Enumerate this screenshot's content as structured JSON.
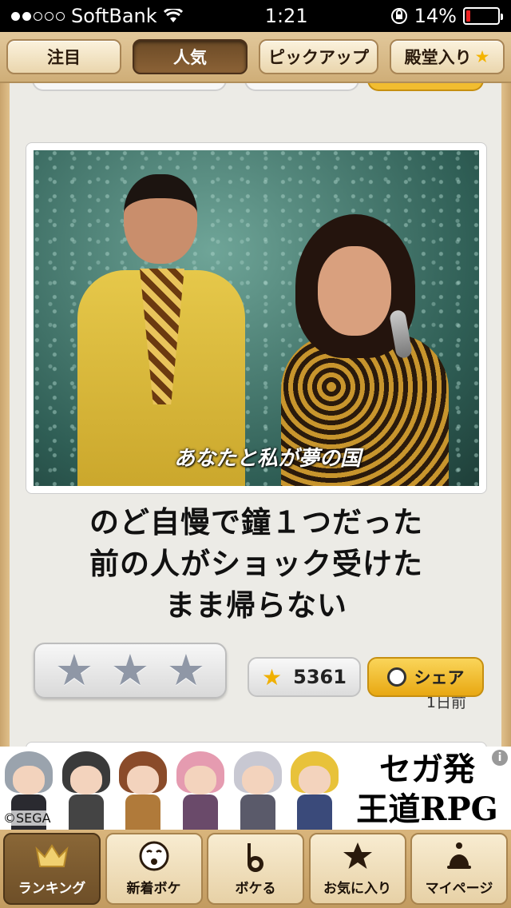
{
  "status_bar": {
    "carrier": "SoftBank",
    "time": "1:21",
    "battery": "14%",
    "battery_level": 0.14
  },
  "top_tabs": [
    {
      "label": "注目",
      "active": false
    },
    {
      "label": "人気",
      "active": true
    },
    {
      "label": "ピックアップ",
      "active": false
    },
    {
      "label": "殿堂入り",
      "active": false,
      "star": "★"
    }
  ],
  "post": {
    "image_caption": "あなたと私が夢の国",
    "title_lines": [
      "のど自慢で鐘１つだった",
      "前の人がショック受けた",
      "まま帰らない"
    ],
    "time_ago": "1日前",
    "rating_stars": 3,
    "score": "5361",
    "share_label": "シェア"
  },
  "ad": {
    "copyright": "©SEGA",
    "line1": "セガ発",
    "line2": "王道RPG",
    "info": "i"
  },
  "bottom_tabs": [
    {
      "label": "ランキング",
      "icon": "crown-icon",
      "active": true
    },
    {
      "label": "新着ボケ",
      "icon": "funny-face-icon",
      "active": false
    },
    {
      "label": "ボケる",
      "icon": "boke-b-icon",
      "active": false
    },
    {
      "label": "お気に入り",
      "icon": "star-icon",
      "active": false
    },
    {
      "label": "マイページ",
      "icon": "bell-icon",
      "active": false
    }
  ],
  "colors": {
    "wood": "#cfae78",
    "active_tab": "#6b4a26",
    "share": "#f2bd30",
    "star_gold": "#f0b000"
  }
}
